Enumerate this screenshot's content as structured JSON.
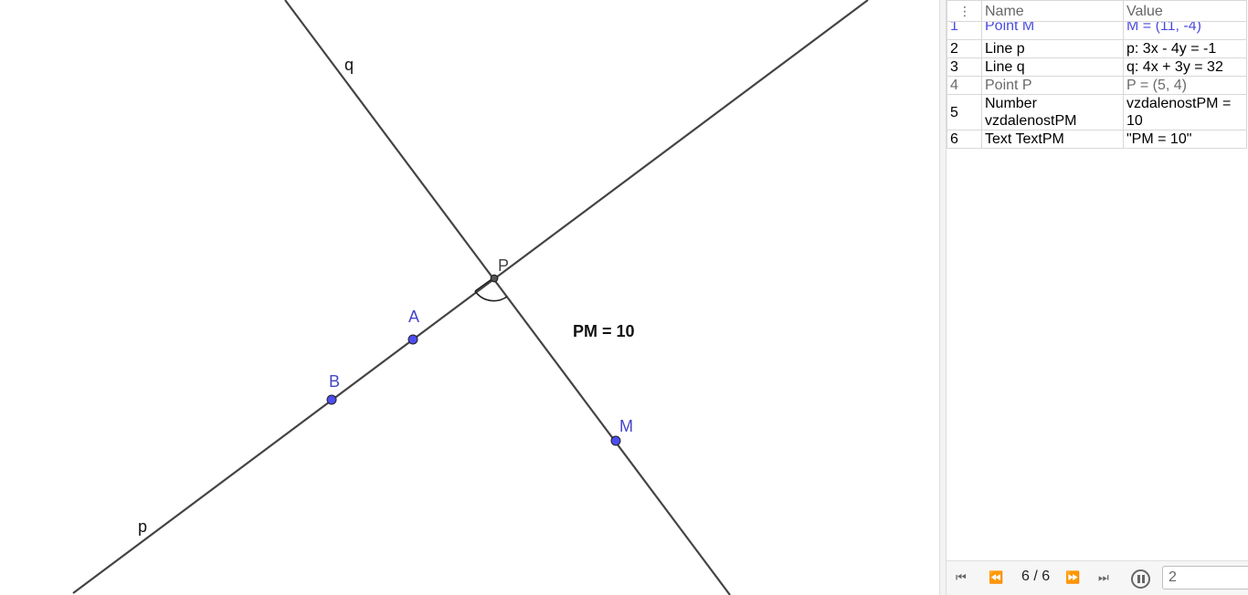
{
  "graphics": {
    "labels": {
      "q": "q",
      "p": "p",
      "P": "P",
      "A": "A",
      "B": "B",
      "M": "M",
      "text": "PM = 10"
    },
    "colors": {
      "point": "#4d4df0",
      "line": "#444444",
      "label_blue": "#4545c8"
    }
  },
  "algebra": {
    "headers": {
      "name": "Name",
      "value": "Value"
    },
    "drag_icon": "vertical-dots-icon",
    "rows": [
      {
        "num": "1",
        "name": "Point M",
        "value": "M = (11, -4)"
      },
      {
        "num": "2",
        "name": "Line p",
        "value": "p: 3x - 4y = -1"
      },
      {
        "num": "3",
        "name": "Line q",
        "value": "q: 4x + 3y = 32"
      },
      {
        "num": "4",
        "name": "Point P",
        "value": "P = (5, 4)"
      },
      {
        "num": "5",
        "name": "Number vzdalenostPM",
        "value": "vzdalenostPM = 10"
      },
      {
        "num": "6",
        "name": "Text TextPM",
        "value": "\"PM = 10\""
      }
    ]
  },
  "navigation": {
    "step": "6 / 6",
    "speed_value": "2",
    "icons": [
      "first-step-icon",
      "previous-step-icon",
      "next-step-icon",
      "last-step-icon",
      "pause-icon"
    ]
  }
}
